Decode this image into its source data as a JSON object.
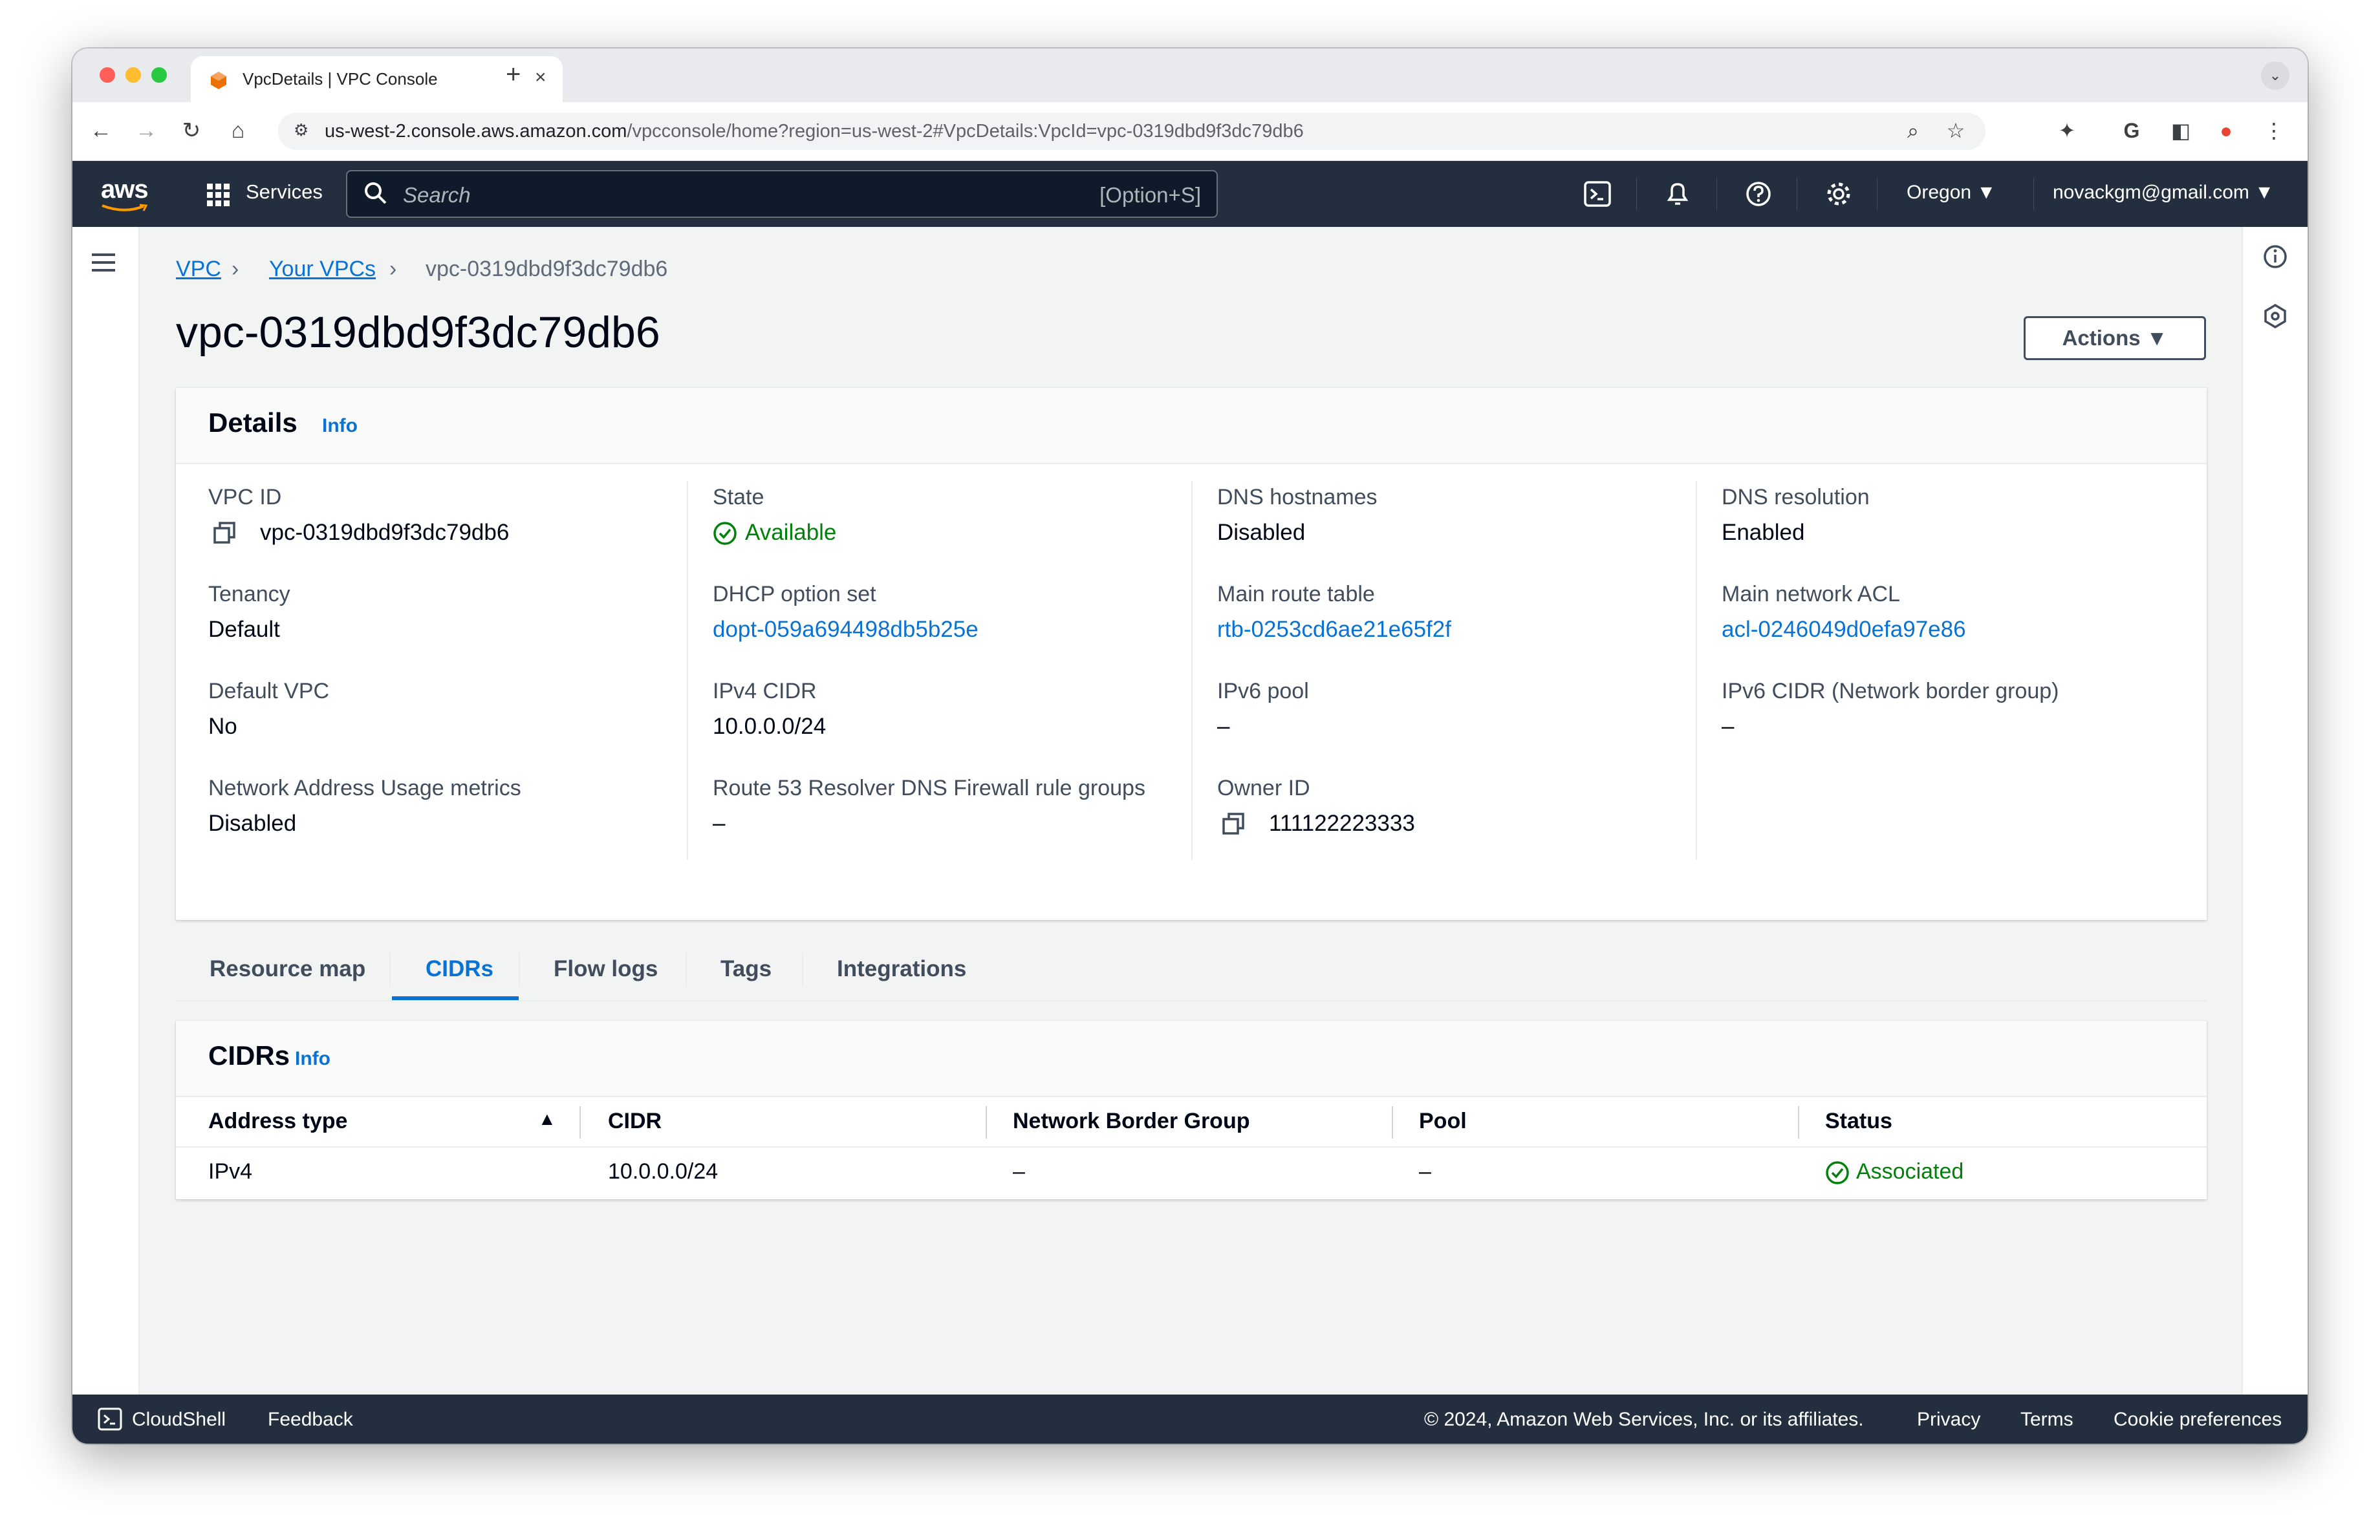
{
  "browser": {
    "tab_title": "VpcDetails | VPC Console",
    "url_host": "us-west-2.console.aws.amazon.com",
    "url_path": "/vpcconsole/home?region=us-west-2#VpcDetails:VpcId=vpc-0319dbd9f3dc79db6"
  },
  "topnav": {
    "logo": "aws",
    "services_label": "Services",
    "search_placeholder": "Search",
    "search_shortcut": "[Option+S]",
    "region": "Oregon",
    "account": "novackgm@gmail.com"
  },
  "breadcrumb": {
    "items": [
      "VPC",
      "Your VPCs"
    ],
    "current": "vpc-0319dbd9f3dc79db6"
  },
  "page": {
    "title": "vpc-0319dbd9f3dc79db6",
    "actions_label": "Actions"
  },
  "details": {
    "title": "Details",
    "info_label": "Info",
    "fields": {
      "vpc_id": {
        "label": "VPC ID",
        "value": "vpc-0319dbd9f3dc79db6"
      },
      "state": {
        "label": "State",
        "value": "Available"
      },
      "dns_hostnames": {
        "label": "DNS hostnames",
        "value": "Disabled"
      },
      "dns_resolution": {
        "label": "DNS resolution",
        "value": "Enabled"
      },
      "tenancy": {
        "label": "Tenancy",
        "value": "Default"
      },
      "dhcp": {
        "label": "DHCP option set",
        "value": "dopt-059a694498db5b25e"
      },
      "main_route_table": {
        "label": "Main route table",
        "value": "rtb-0253cd6ae21e65f2f"
      },
      "main_acl": {
        "label": "Main network ACL",
        "value": "acl-0246049d0efa97e86"
      },
      "default_vpc": {
        "label": "Default VPC",
        "value": "No"
      },
      "ipv4_cidr": {
        "label": "IPv4 CIDR",
        "value": "10.0.0.0/24"
      },
      "ipv6_pool": {
        "label": "IPv6 pool",
        "value": "–"
      },
      "ipv6_cidr": {
        "label": "IPv6 CIDR (Network border group)",
        "value": "–"
      },
      "nau_metrics": {
        "label": "Network Address Usage metrics",
        "value": "Disabled"
      },
      "route53": {
        "label": "Route 53 Resolver DNS Firewall rule groups",
        "value": "–"
      },
      "owner_id": {
        "label": "Owner ID",
        "value": "111122223333"
      }
    }
  },
  "tabs": [
    "Resource map",
    "CIDRs",
    "Flow logs",
    "Tags",
    "Integrations"
  ],
  "active_tab": "CIDRs",
  "cidrs": {
    "title": "CIDRs",
    "info_label": "Info",
    "columns": [
      "Address type",
      "CIDR",
      "Network Border Group",
      "Pool",
      "Status"
    ],
    "rows": [
      {
        "address_type": "IPv4",
        "cidr": "10.0.0.0/24",
        "nbg": "–",
        "pool": "–",
        "status": "Associated"
      }
    ]
  },
  "footer": {
    "cloudshell": "CloudShell",
    "feedback": "Feedback",
    "copyright": "© 2024, Amazon Web Services, Inc. or its affiliates.",
    "privacy": "Privacy",
    "terms": "Terms",
    "cookies": "Cookie preferences"
  },
  "colors": {
    "nav_bg": "#232f3e",
    "link": "#0972d3",
    "success": "#037f0c"
  }
}
